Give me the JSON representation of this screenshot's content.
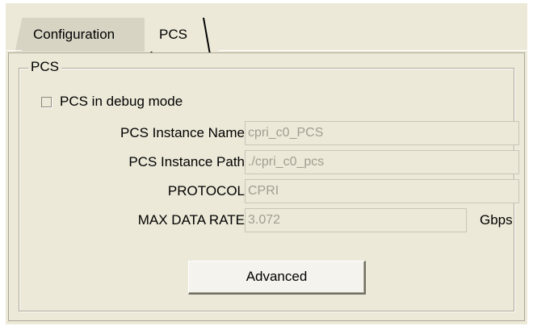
{
  "tabs": [
    {
      "label": "Configuration",
      "active": false
    },
    {
      "label": "PCS",
      "active": true
    }
  ],
  "group": {
    "title": "PCS"
  },
  "debug_checkbox": {
    "label": "PCS in debug mode",
    "checked": false
  },
  "fields": [
    {
      "label": "PCS Instance Name",
      "value": "cpri_c0_PCS"
    },
    {
      "label": "PCS Instance Path",
      "value": "./cpri_c0_pcs"
    },
    {
      "label": "PROTOCOL",
      "value": "CPRI"
    },
    {
      "label": "MAX DATA RATE",
      "value": "3.072",
      "unit": "Gbps"
    }
  ],
  "advanced_button": {
    "label": "Advanced"
  }
}
